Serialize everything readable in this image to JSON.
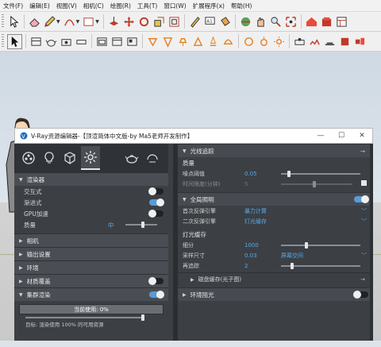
{
  "menubar": {
    "items": [
      "文件(F)",
      "编辑(E)",
      "视图(V)",
      "相机(C)",
      "绘图(R)",
      "工具(T)",
      "窗口(W)",
      "扩展程序(x)",
      "帮助(H)"
    ]
  },
  "toolbar1": {
    "icons": [
      "select-icon",
      "eraser-icon",
      "pencil-icon",
      "arc-icon",
      "shape-icon",
      "pushpull-icon",
      "move-icon",
      "rotate-icon",
      "scale-icon",
      "offset-icon",
      "tape-icon",
      "text-icon",
      "paint-icon",
      "orbit-icon",
      "pan-icon",
      "zoom-icon",
      "zoom-extents-icon",
      "warehouse-icon",
      "extension-warehouse-icon",
      "layout-icon"
    ]
  },
  "toolbar2": {
    "icons": [
      "cursor-icon",
      "component-icon",
      "teapot-icon",
      "sphere-icon",
      "flat-icon",
      "window-icon",
      "frame-icon",
      "layers-icon",
      "light-bulb-icon",
      "triangle-icon",
      "lamp-icon",
      "mesh-icon",
      "rect-light-icon",
      "dome-light-icon",
      "ies-icon",
      "sphere-light-icon",
      "sun-icon",
      "proxy-icon",
      "fur-icon",
      "plane-icon",
      "mesh-export-icon",
      "batch-icon"
    ]
  },
  "vray": {
    "title": "V-Ray资源编辑器-【顶渲简体中文版-by Ma5老师开发制作】",
    "window_controls": [
      "—",
      "☐",
      "✕"
    ],
    "tabs": [
      "materials-tab-icon",
      "lights-tab-icon",
      "geometry-tab-icon",
      "settings-tab-icon"
    ],
    "left": {
      "renderer": {
        "title": "渲染器",
        "rows": [
          {
            "label": "交互式",
            "toggle": false
          },
          {
            "label": "渐进式",
            "toggle": true
          },
          {
            "label": "GPU加速",
            "toggle": false
          }
        ],
        "quality_label": "质量",
        "quality_value": "中"
      },
      "sections": [
        "相机",
        "输出设置",
        "环境",
        "材质覆盖",
        "集群渲染"
      ],
      "material_override_on": false,
      "swarm_on": true,
      "progress_text": "当前使用: 0%",
      "progress_note": "目标: 渲染使用 100% 的可用资源"
    },
    "right": {
      "raytrace": {
        "title": "光线追踪",
        "quality_title": "质量",
        "noise_label": "噪点阈值",
        "noise_value": "0.05",
        "time_label": "时间限度(分钟)",
        "time_value": "5"
      },
      "gi": {
        "title": "全局照明",
        "primary_label": "首次反弹引擎",
        "primary_value": "暴力计算",
        "secondary_label": "二次反弹引擎",
        "secondary_value": "灯光缓存",
        "lc_title": "灯光缓存",
        "subdiv_label": "细分",
        "subdiv_value": "1000",
        "sample_label": "采样尺寸",
        "sample_value": "0.03",
        "sample_mode": "屏幕空间",
        "retrace_label": "再追踪",
        "retrace_value": "2",
        "disk_cache": "磁盘缓存(光子图)"
      },
      "ao": {
        "title": "环境阻光",
        "on": false
      }
    }
  },
  "colors": {
    "accent": "#5aa7e6",
    "toggle_on": "#5a9bd5",
    "panel_bg": "#3c4045"
  }
}
